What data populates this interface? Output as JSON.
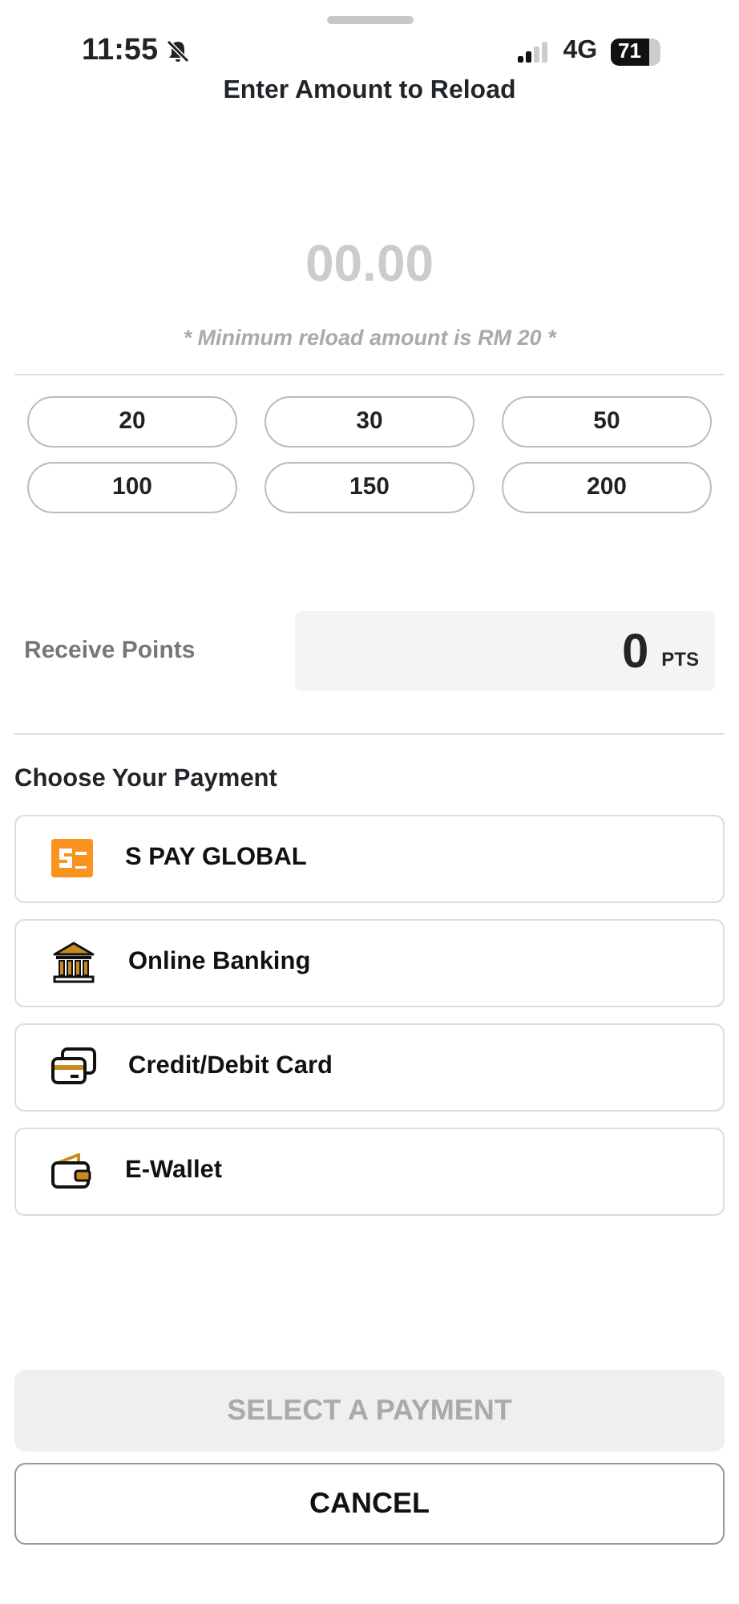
{
  "status_bar": {
    "time": "11:55",
    "silent": true,
    "network": "4G",
    "battery": "71"
  },
  "title": "Enter Amount to Reload",
  "amount": {
    "placeholder": "00.00"
  },
  "minimum_note": "* Minimum reload amount is RM 20 *",
  "preset_amounts": [
    {
      "label": "20",
      "selected": false
    },
    {
      "label": "30",
      "selected": false
    },
    {
      "label": "50",
      "selected": false
    },
    {
      "label": "100",
      "selected": false
    },
    {
      "label": "150",
      "selected": false
    },
    {
      "label": "200",
      "selected": false
    }
  ],
  "receive_points": {
    "label": "Receive Points",
    "value": "0",
    "unit": "PTS"
  },
  "payment_heading": "Choose Your Payment",
  "payments": [
    {
      "kind": "spay",
      "label": "S PAY GLOBAL",
      "selected": false
    },
    {
      "kind": "bank",
      "label": "Online Banking",
      "selected": false
    },
    {
      "kind": "card",
      "label": "Credit/Debit Card",
      "selected": false
    },
    {
      "kind": "wallet",
      "label": "E-Wallet",
      "selected": false
    }
  ],
  "submit": {
    "label": "SELECT A PAYMENT",
    "disabled": true
  },
  "cancel": {
    "label": "CANCEL"
  }
}
